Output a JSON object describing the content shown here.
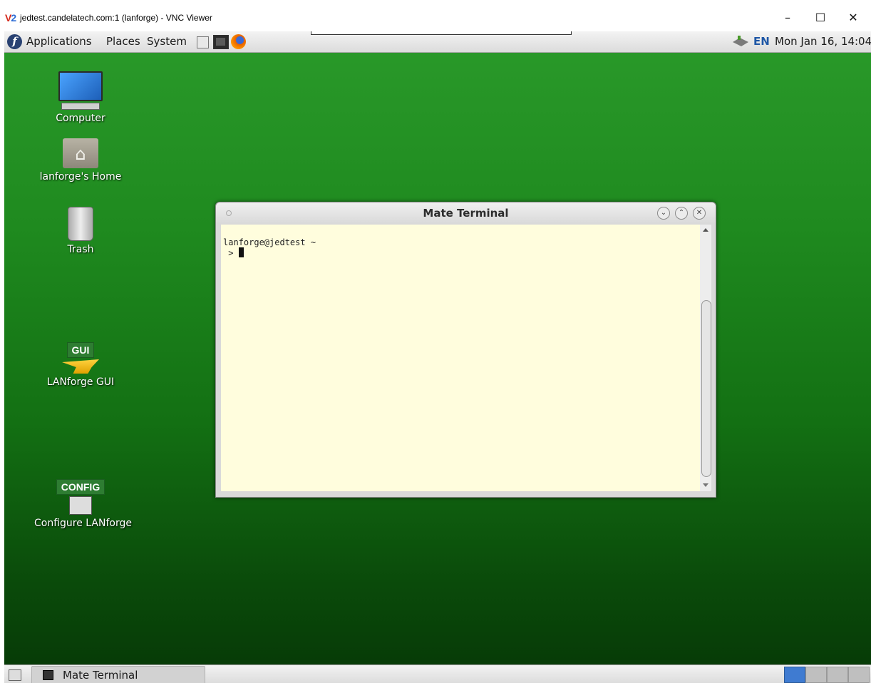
{
  "vnc_window": {
    "logo": "V2",
    "title": "jedtest.candelatech.com:1 (lanforge) - VNC Viewer",
    "minimize_label": "–",
    "maximize_label": "☐",
    "close_label": "✕"
  },
  "top_panel": {
    "menus": [
      "Applications",
      "Places",
      "System"
    ],
    "lang": "EN",
    "clock": "Mon Jan 16, 14:04"
  },
  "desktop_icons": {
    "computer": "Computer",
    "home": "lanforge's Home",
    "trash": "Trash",
    "gui_badge": "GUI",
    "gui": "LANforge GUI",
    "config_badge": "CONFIG",
    "config": "Configure LANforge"
  },
  "terminal": {
    "title": "Mate Terminal",
    "line1": "lanforge@jedtest ~",
    "line2": " > "
  },
  "bottom_panel": {
    "task_label": "Mate Terminal"
  }
}
